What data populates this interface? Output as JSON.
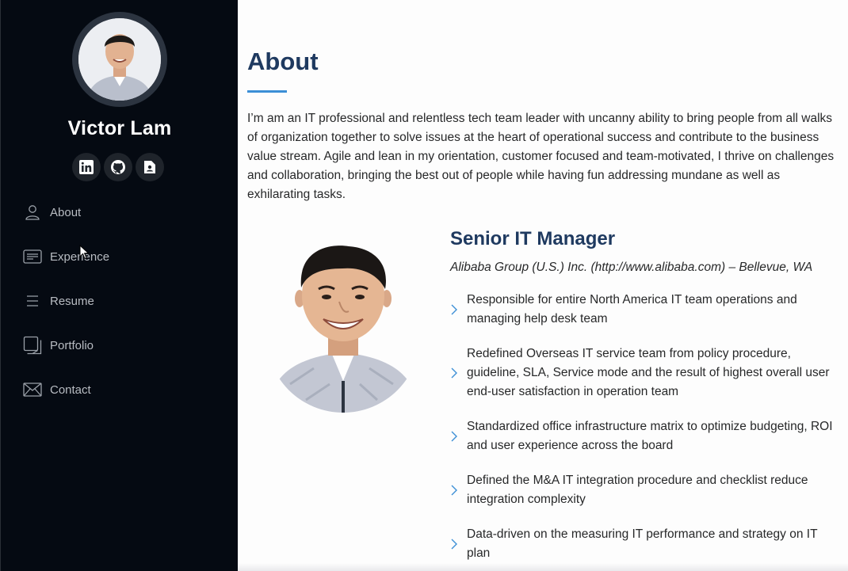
{
  "profile": {
    "name": "Victor Lam",
    "social": [
      {
        "icon": "linkedin-icon"
      },
      {
        "icon": "github-icon"
      },
      {
        "icon": "resume-file-icon"
      }
    ]
  },
  "nav": {
    "items": [
      {
        "label": "About",
        "icon": "person-icon"
      },
      {
        "label": "Experience",
        "icon": "card-icon"
      },
      {
        "label": "Resume",
        "icon": "list-icon"
      },
      {
        "label": "Portfolio",
        "icon": "stack-icon"
      },
      {
        "label": "Contact",
        "icon": "envelope-icon"
      }
    ]
  },
  "about": {
    "title": "About",
    "text": "I’m am an IT professional and relentless tech team leader with uncanny ability to bring people from all walks of organization together to solve issues at the heart of operational success and contribute to the business value stream. Agile and lean in my orientation, customer focused and team-motivated, I thrive on challenges and collaboration, bringing the best out of people while having fun addressing mundane as well as exhilarating tasks."
  },
  "job": {
    "title": "Senior IT Manager",
    "company": "Alibaba Group (U.S.) Inc. (http://www.alibaba.com) – Bellevue, WA",
    "bullets": [
      "Responsible for entire North America IT team operations and managing help desk team",
      "Redefined Overseas IT service team from policy procedure, guideline, SLA, Service mode and the result of highest overall user end-user satisfaction in operation team",
      "Standardized office infrastructure matrix to optimize budgeting, ROI and user experience across the board",
      "Defined the M&A IT integration procedure and checklist reduce integration complexity",
      "Data-driven on the measuring IT performance and strategy on IT plan"
    ]
  },
  "colors": {
    "sidebar_bg": "#050a12",
    "heading": "#1f3a60",
    "accent": "#3c8fd6",
    "nav_text": "#b8bcc2"
  }
}
